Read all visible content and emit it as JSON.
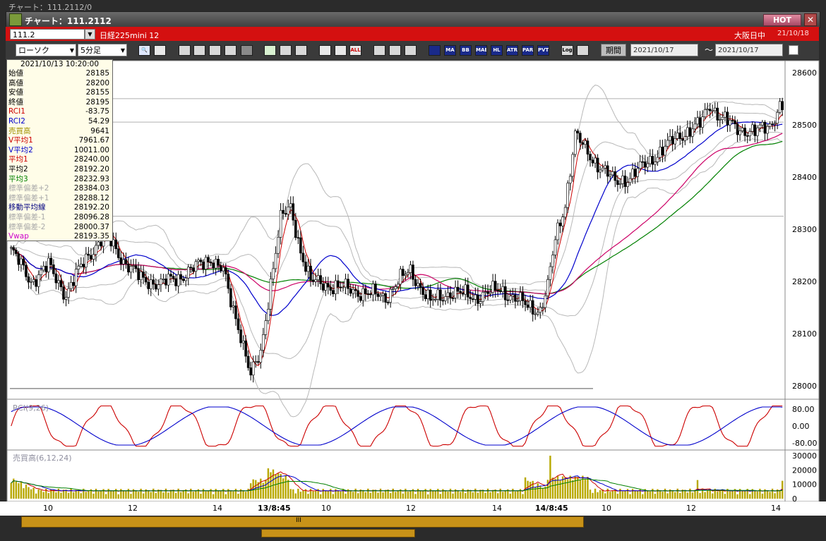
{
  "window": {
    "background_title": "チャート：111.2112/0",
    "title": "チャート：111.2112",
    "hot_label": "HOT",
    "close_label": "✕"
  },
  "header": {
    "symbol_code": "111.2",
    "symbol_name": "日経225mini 12",
    "market_status": "大阪日中",
    "date": "21/10/18"
  },
  "toolbar": {
    "chart_type": "ローソク",
    "interval": "5分足",
    "period_label": "期間",
    "date_from": "2021/10/17",
    "date_to": "2021/10/17",
    "range_sep": "～",
    "buttons": [
      "MA",
      "BB",
      "MAE",
      "HL",
      "ATR",
      "PARA",
      "PVT",
      "Log"
    ],
    "all_label": "ALL"
  },
  "info_panel": {
    "datetime": "2021/10/13  10:20:00",
    "rows": [
      {
        "label": "始値",
        "value": "28185",
        "color": "#000000"
      },
      {
        "label": "高値",
        "value": "28200",
        "color": "#000000"
      },
      {
        "label": "安値",
        "value": "28155",
        "color": "#000000"
      },
      {
        "label": "終値",
        "value": "28195",
        "color": "#000000"
      },
      {
        "label": "RCI1",
        "value": "-83.75",
        "color": "#cc0000"
      },
      {
        "label": "RCI2",
        "value": "54.29",
        "color": "#0000cc"
      },
      {
        "label": "売買高",
        "value": "9641",
        "color": "#a09000"
      },
      {
        "label": "V平均1",
        "value": "7961.67",
        "color": "#cc0000"
      },
      {
        "label": "V平均2",
        "value": "10011.00",
        "color": "#0000cc"
      },
      {
        "label": "平均1",
        "value": "28240.00",
        "color": "#cc0000"
      },
      {
        "label": "平均2",
        "value": "28192.20",
        "color": "#000000"
      },
      {
        "label": "平均3",
        "value": "28232.93",
        "color": "#008000"
      },
      {
        "label": "標準偏差+2",
        "value": "28384.03",
        "color": "#aaaaaa"
      },
      {
        "label": "標準偏差+1",
        "value": "28288.12",
        "color": "#aaaaaa"
      },
      {
        "label": "移動平均線",
        "value": "28192.20",
        "color": "#000080"
      },
      {
        "label": "標準偏差-1",
        "value": "28096.28",
        "color": "#aaaaaa"
      },
      {
        "label": "標準偏差-2",
        "value": "28000.37",
        "color": "#aaaaaa"
      },
      {
        "label": "Vwap",
        "value": "28193.35",
        "color": "#cc00cc"
      }
    ]
  },
  "price_axis_labels": [
    "28600",
    "28500",
    "28400",
    "28300",
    "28200",
    "28100",
    "28000"
  ],
  "rci_axis_labels": [
    "80.00",
    "0.00",
    "-80.00"
  ],
  "volume_axis_labels": [
    "30000",
    "20000",
    "10000",
    "0"
  ],
  "rci_label": "RCI(9,26)",
  "volume_label": "売買高(6,12,24)",
  "x_labels": [
    "10",
    "12",
    "14",
    "13/8:45",
    "10",
    "12",
    "14",
    "14/8:45",
    "10",
    "12",
    "14"
  ],
  "scroll_grip": "III",
  "colors": {
    "accent_red": "#d41010",
    "up_candle": "#ffffff",
    "down_candle": "#000000",
    "ma_short": "#cc0000",
    "ma_mid": "#0000cc",
    "ma_long": "#008000",
    "vwap": "#cc0066",
    "volume": "#b8a800"
  },
  "chart_data": {
    "type": "candlestick",
    "price_axis": {
      "min": 27980,
      "max": 28620,
      "ticks": [
        28000,
        28100,
        28200,
        28300,
        28400,
        28500,
        28600
      ]
    },
    "rci_axis": {
      "min": -100,
      "max": 100,
      "ticks": [
        80,
        0,
        -80
      ]
    },
    "volume_axis": {
      "min": 0,
      "max": 32000,
      "ticks": [
        0,
        10000,
        20000,
        30000
      ]
    },
    "price_path": [
      [
        0,
        28260
      ],
      [
        8,
        28200
      ],
      [
        15,
        28230
      ],
      [
        22,
        28175
      ],
      [
        30,
        28245
      ],
      [
        38,
        28290
      ],
      [
        45,
        28240
      ],
      [
        52,
        28205
      ],
      [
        60,
        28195
      ],
      [
        68,
        28210
      ],
      [
        75,
        28230
      ],
      [
        80,
        28245
      ],
      [
        85,
        28220
      ],
      [
        88,
        28160
      ],
      [
        92,
        28100
      ],
      [
        96,
        28020
      ],
      [
        100,
        28060
      ],
      [
        104,
        28200
      ],
      [
        108,
        28320
      ],
      [
        112,
        28340
      ],
      [
        116,
        28260
      ],
      [
        120,
        28200
      ],
      [
        130,
        28190
      ],
      [
        140,
        28180
      ],
      [
        150,
        28170
      ],
      [
        155,
        28200
      ],
      [
        160,
        28220
      ],
      [
        168,
        28160
      ],
      [
        176,
        28180
      ],
      [
        186,
        28170
      ],
      [
        196,
        28185
      ],
      [
        206,
        28155
      ],
      [
        212,
        28145
      ],
      [
        215,
        28190
      ],
      [
        218,
        28280
      ],
      [
        222,
        28350
      ],
      [
        226,
        28480
      ],
      [
        232,
        28440
      ],
      [
        236,
        28420
      ],
      [
        242,
        28390
      ],
      [
        248,
        28400
      ],
      [
        258,
        28440
      ],
      [
        268,
        28480
      ],
      [
        276,
        28500
      ],
      [
        280,
        28540
      ],
      [
        284,
        28515
      ],
      [
        290,
        28495
      ],
      [
        298,
        28485
      ],
      [
        304,
        28500
      ],
      [
        308,
        28535
      ]
    ]
  }
}
